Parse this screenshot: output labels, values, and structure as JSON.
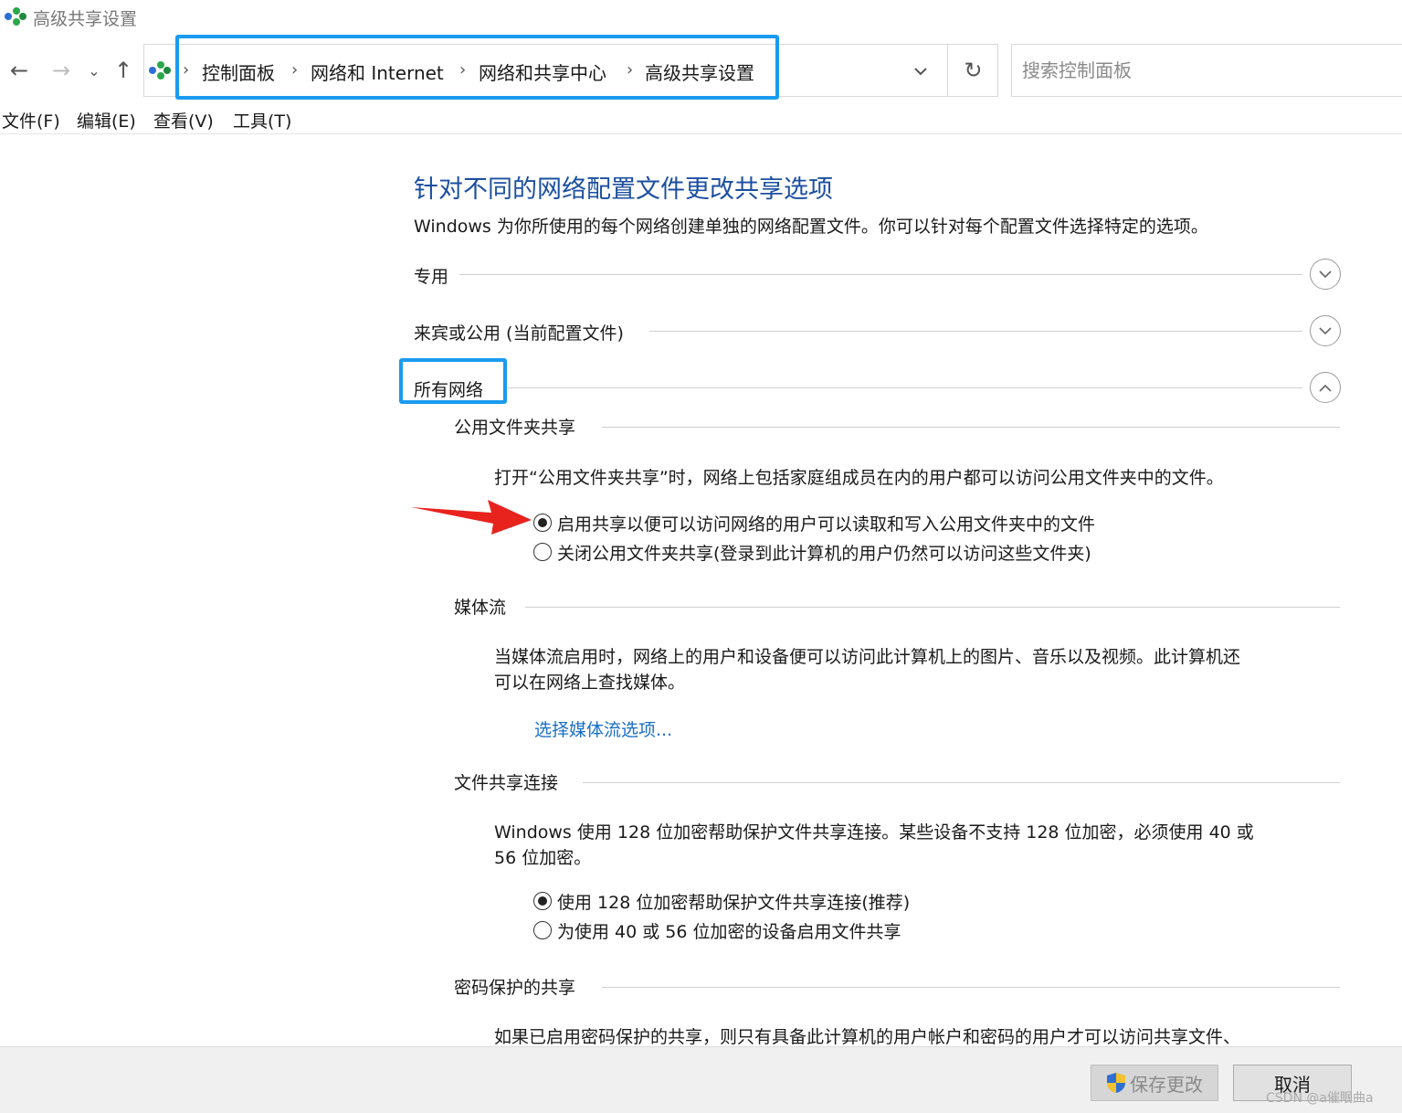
{
  "window": {
    "title": "高级共享设置"
  },
  "navigation": {
    "back_icon": "←",
    "forward_icon": "→",
    "recent_icon": "⌄",
    "up_icon": "↑",
    "breadcrumbs": [
      "控制面板",
      "网络和 Internet",
      "网络和共享中心",
      "高级共享设置"
    ],
    "refresh_icon": "↻",
    "search_placeholder": "搜索控制面板"
  },
  "menu": [
    "文件(F)",
    "编辑(E)",
    "查看(V)",
    "工具(T)"
  ],
  "main": {
    "heading": "针对不同的网络配置文件更改共享选项",
    "description": "Windows 为你所使用的每个网络创建单独的网络配置文件。你可以针对每个配置文件选择特定的选项。",
    "profiles": [
      {
        "label": "专用",
        "expanded": false
      },
      {
        "label": "来宾或公用 (当前配置文件)",
        "expanded": false
      },
      {
        "label": "所有网络",
        "expanded": true
      }
    ],
    "public_folder": {
      "title": "公用文件夹共享",
      "text": "打开“公用文件夹共享”时，网络上包括家庭组成员在内的用户都可以访问公用文件夹中的文件。",
      "options": [
        {
          "label": "启用共享以便可以访问网络的用户可以读取和写入公用文件夹中的文件",
          "selected": true
        },
        {
          "label": "关闭公用文件夹共享(登录到此计算机的用户仍然可以访问这些文件夹)",
          "selected": false
        }
      ]
    },
    "media": {
      "title": "媒体流",
      "text_line1": "当媒体流启用时，网络上的用户和设备便可以访问此计算机上的图片、音乐以及视频。此计算机还",
      "text_line2": "可以在网络上查找媒体。",
      "link": "选择媒体流选项..."
    },
    "file_sharing": {
      "title": "文件共享连接",
      "text_line1": "Windows 使用 128 位加密帮助保护文件共享连接。某些设备不支持 128 位加密，必须使用 40 或",
      "text_line2": "56 位加密。",
      "options": [
        {
          "label": "使用 128 位加密帮助保护文件共享连接(推荐)",
          "selected": true
        },
        {
          "label": "为使用 40 或 56 位加密的设备启用文件共享",
          "selected": false
        }
      ]
    },
    "password": {
      "title": "密码保护的共享",
      "text": "如果已启用密码保护的共享，则只有具备此计算机的用户帐户和密码的用户才可以访问共享文件、"
    }
  },
  "footer": {
    "save_label": "保存更改",
    "cancel_label": "取消",
    "watermark": "CSDN @a催眠曲a"
  },
  "colors": {
    "heading": "#1c4fa0",
    "highlight": "#1a9bf0",
    "arrow": "#e8231e",
    "link": "#1a6fc7"
  },
  "icons": {
    "app": "network-icon",
    "shield": "uac-shield-icon",
    "arrow": "red-arrow-annotation"
  }
}
